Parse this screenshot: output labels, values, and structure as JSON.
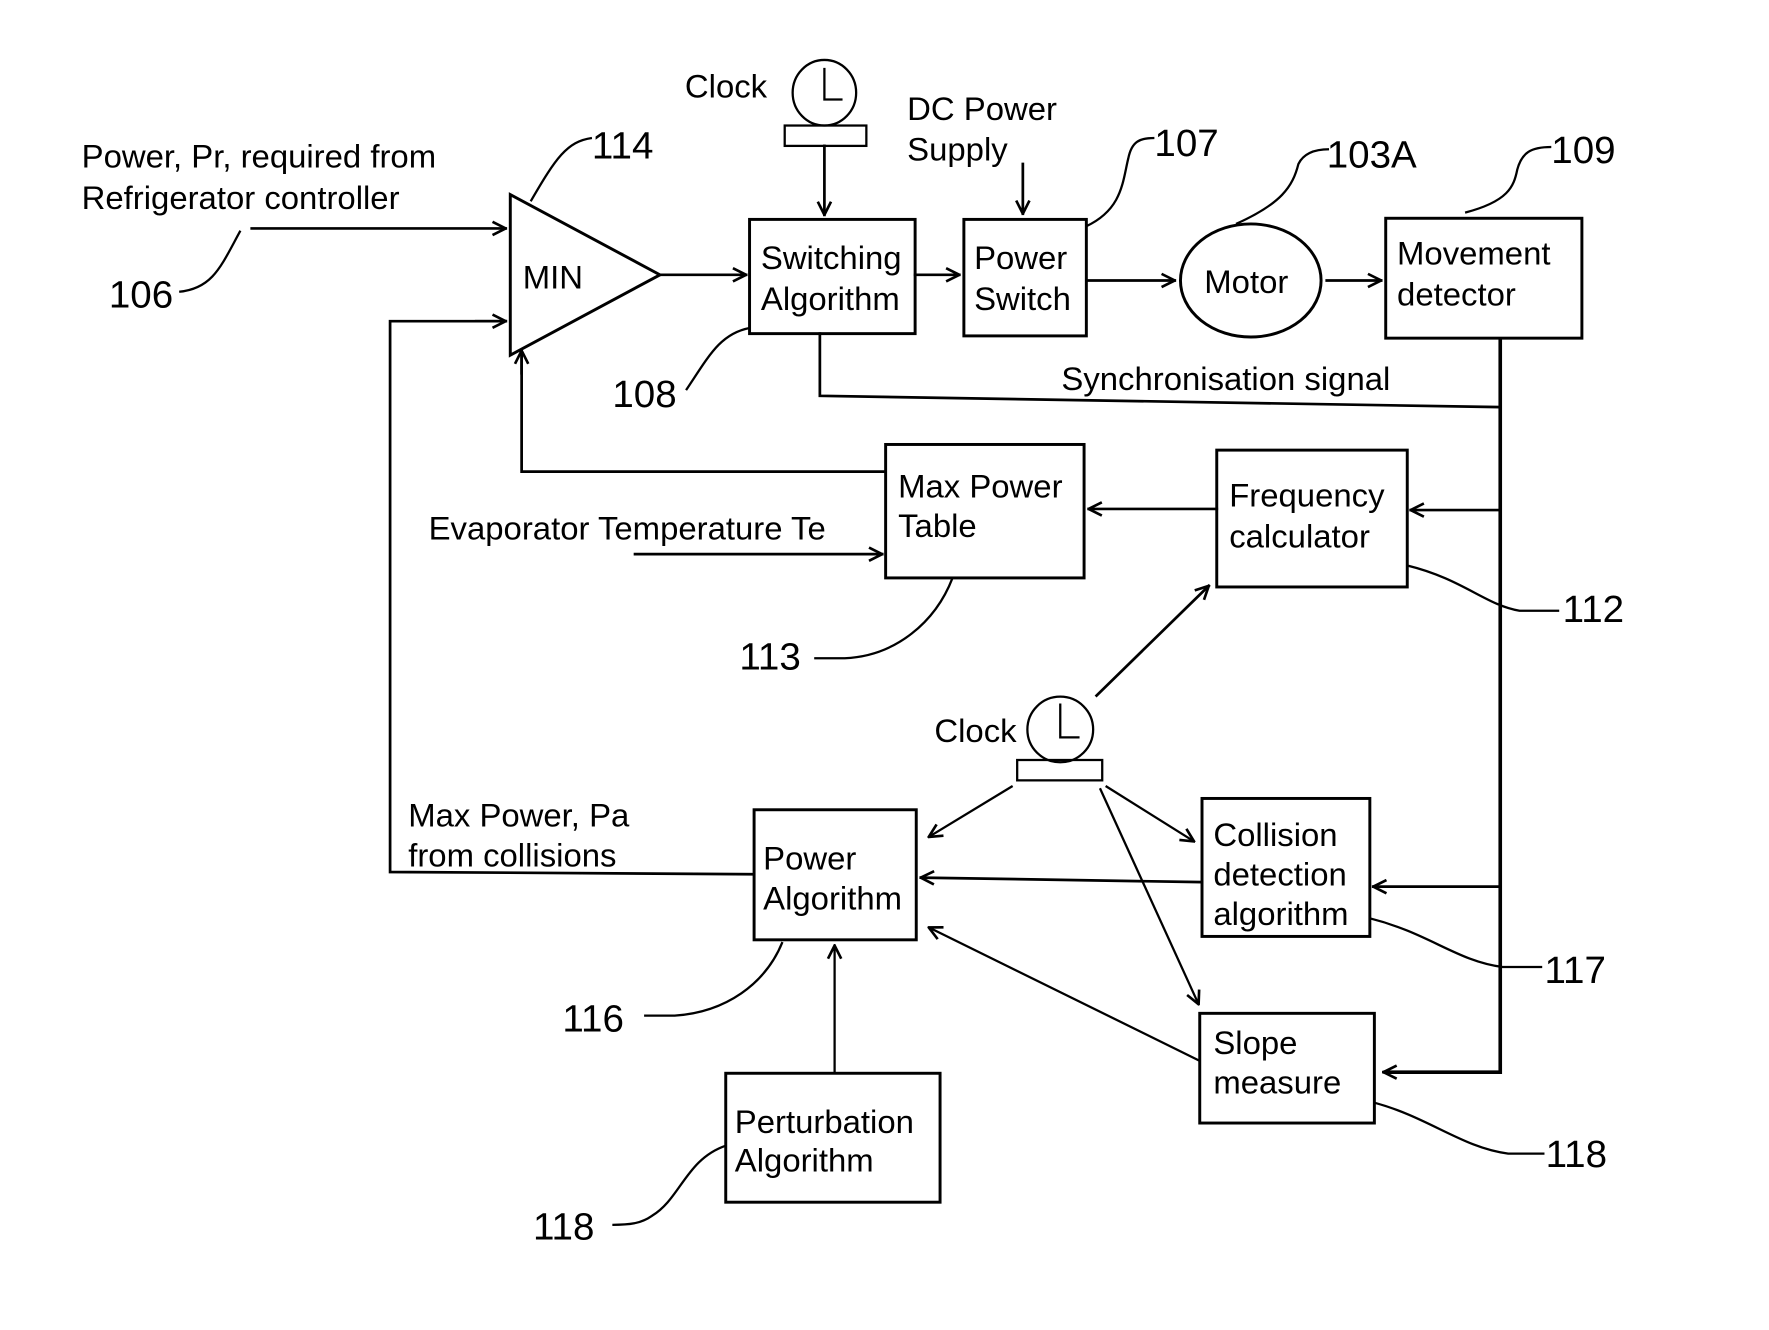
{
  "figure": {
    "type": "block-diagram",
    "description": "Motor power control with collision detection"
  },
  "inputs": {
    "power_required": [
      "Power, Pr, required from",
      "Refrigerator controller"
    ],
    "dc_power_supply": [
      "DC Power",
      "Supply"
    ],
    "evaporator_temperature": "Evaporator Temperature Te",
    "synchronisation_signal": "Synchronisation signal",
    "max_power_from_collisions": [
      "Max Power, Pa",
      "from collisions"
    ]
  },
  "blocks": {
    "min": "MIN",
    "switching_algorithm": [
      "Switching",
      "Algorithm"
    ],
    "power_switch": [
      "Power",
      "Switch"
    ],
    "motor": "Motor",
    "movement_detector": [
      "Movement",
      "detector"
    ],
    "max_power_table": [
      "Max Power",
      "Table"
    ],
    "frequency_calculator": [
      "Frequency",
      "calculator"
    ],
    "power_algorithm": [
      "Power",
      "Algorithm"
    ],
    "collision_detection": [
      "Collision",
      "detection",
      "algorithm"
    ],
    "slope_measure": [
      "Slope",
      "measure"
    ],
    "perturbation_algorithm": [
      "Perturbation",
      "Algorithm"
    ]
  },
  "clocks": {
    "top_clock_label": "Clock",
    "bottom_clock_label": "Clock"
  },
  "reference_numerals": {
    "power_input": "106",
    "min": "114",
    "switching_algorithm": "108",
    "power_switch": "107",
    "motor": "103A",
    "movement_detector": "109",
    "frequency_calculator": "112",
    "max_power_table": "113",
    "power_algorithm": "116",
    "collision_detection": "117",
    "slope_measure": "118",
    "perturbation_algorithm": "118"
  }
}
